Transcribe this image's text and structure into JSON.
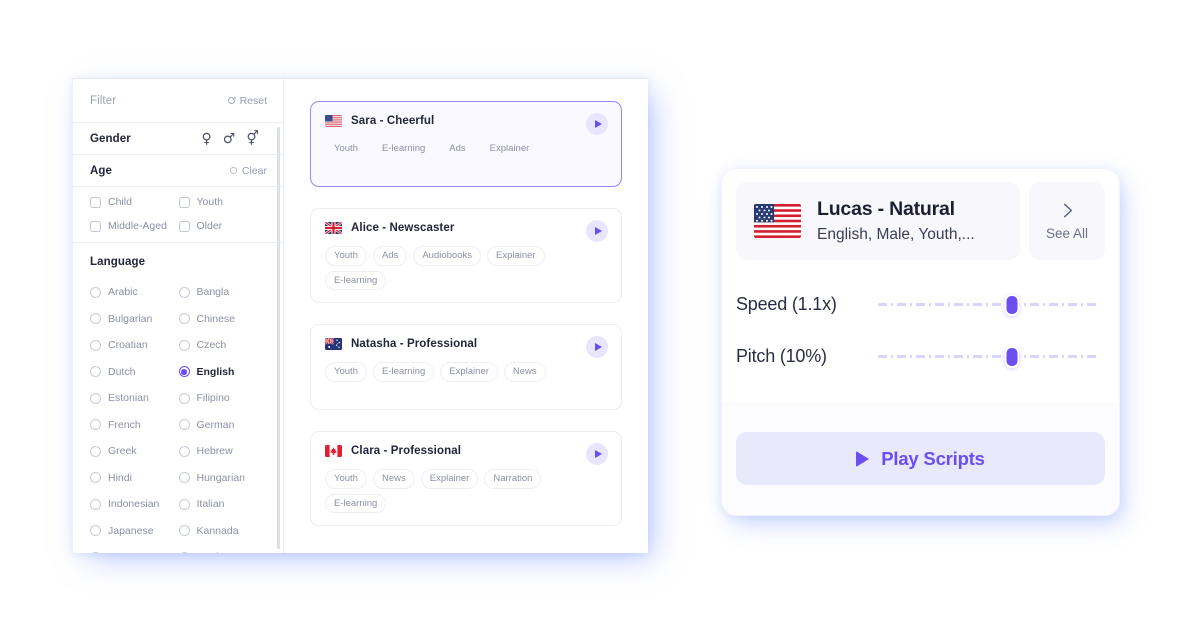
{
  "filter_panel": {
    "header": {
      "title": "Filter",
      "reset_label": "Reset",
      "reset_icon": "refresh-icon"
    },
    "gender": {
      "title": "Gender",
      "options": [
        {
          "icon": "female-icon",
          "glyph": "♀"
        },
        {
          "icon": "male-icon",
          "glyph": "♂"
        },
        {
          "icon": "male-female-icon",
          "glyph": "⚥"
        }
      ]
    },
    "age": {
      "title": "Age",
      "clear_label": "Clear",
      "clear_icon": "circle-icon",
      "options": [
        {
          "label": "Child",
          "checked": false
        },
        {
          "label": "Youth",
          "checked": false
        },
        {
          "label": "Middle-Aged",
          "checked": false
        },
        {
          "label": "Older",
          "checked": false
        }
      ]
    },
    "language": {
      "title": "Language",
      "options": [
        {
          "label": "Arabic",
          "selected": false
        },
        {
          "label": "Bangla",
          "selected": false
        },
        {
          "label": "Bulgarian",
          "selected": false
        },
        {
          "label": "Chinese",
          "selected": false
        },
        {
          "label": "Croatian",
          "selected": false
        },
        {
          "label": "Czech",
          "selected": false
        },
        {
          "label": "Dutch",
          "selected": false
        },
        {
          "label": "English",
          "selected": true
        },
        {
          "label": "Estonian",
          "selected": false
        },
        {
          "label": "Filipino",
          "selected": false
        },
        {
          "label": "French",
          "selected": false
        },
        {
          "label": "German",
          "selected": false
        },
        {
          "label": "Greek",
          "selected": false
        },
        {
          "label": "Hebrew",
          "selected": false
        },
        {
          "label": "Hindi",
          "selected": false
        },
        {
          "label": "Hungarian",
          "selected": false
        },
        {
          "label": "Indonesian",
          "selected": false
        },
        {
          "label": "Italian",
          "selected": false
        },
        {
          "label": "Japanese",
          "selected": false
        },
        {
          "label": "Kannada",
          "selected": false
        },
        {
          "label": "Korean",
          "selected": false
        },
        {
          "label": "Latvian",
          "selected": false
        }
      ]
    }
  },
  "voice_list": {
    "cards": [
      {
        "name": "Sara - Cheerful",
        "flag": "us-flag",
        "selected": true,
        "tags": [
          "Youth",
          "E-learning",
          "Ads",
          "Explainer"
        ]
      },
      {
        "name": "Alice - Newscaster",
        "flag": "uk-flag",
        "selected": false,
        "tags": [
          "Youth",
          "Ads",
          "Audiobooks",
          "Explainer",
          "E-learning"
        ]
      },
      {
        "name": "Natasha - Professional",
        "flag": "au-flag",
        "selected": false,
        "tags": [
          "Youth",
          "E-learning",
          "Explainer",
          "News"
        ]
      },
      {
        "name": "Clara - Professional",
        "flag": "ca-flag",
        "selected": false,
        "tags": [
          "Youth",
          "News",
          "Explainer",
          "Narration",
          "E-learning"
        ]
      }
    ]
  },
  "voice_settings": {
    "selected_voice": {
      "flag": "us-flag",
      "name": "Lucas - Natural",
      "meta": "English, Male, Youth,..."
    },
    "see_all": {
      "label": "See All",
      "icon": "chevron-right-icon"
    },
    "sliders": [
      {
        "label": "Speed (1.1x)",
        "value_pct": 61
      },
      {
        "label": "Pitch (10%)",
        "value_pct": 61
      }
    ],
    "play_scripts": {
      "label": "Play Scripts",
      "icon": "play-icon"
    }
  },
  "colors": {
    "accent": "#6c4df0",
    "accent_soft": "#e8e5fd",
    "footer_bg": "#e8eafc",
    "selected_card_bg": "#faf9ff",
    "selected_card_border": "#9b86f5"
  }
}
